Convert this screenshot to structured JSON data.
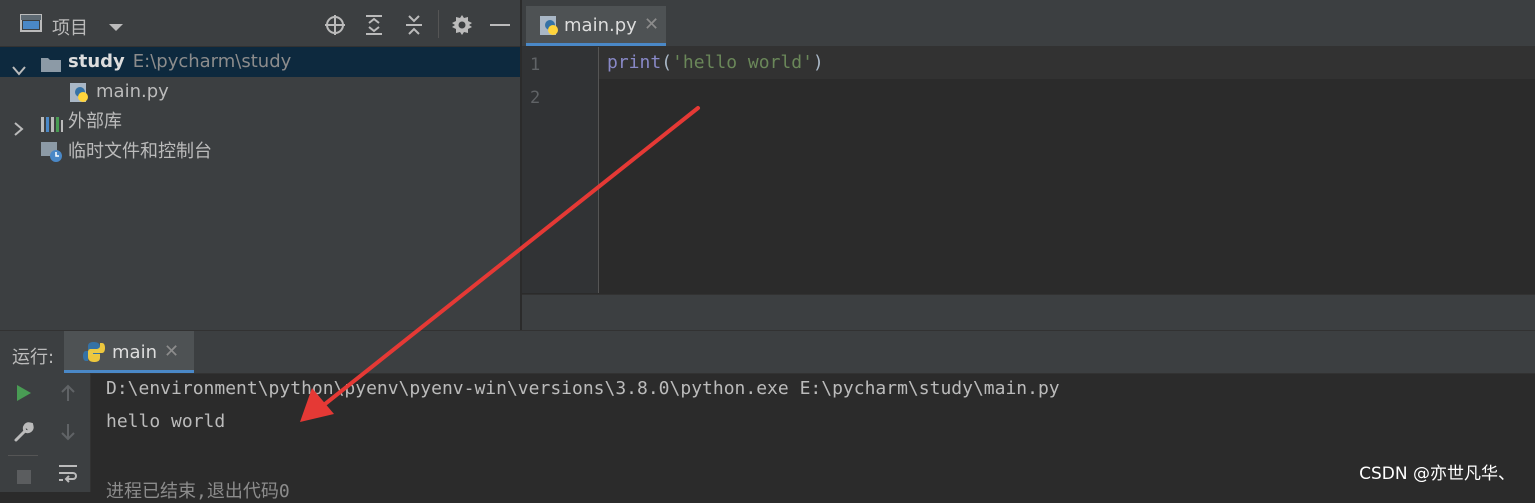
{
  "project": {
    "title": "项目",
    "tree": [
      {
        "name": "study",
        "path": "E:\\pycharm\\study"
      },
      {
        "name": "main.py"
      },
      {
        "name": "外部库"
      },
      {
        "name": "临时文件和控制台"
      }
    ]
  },
  "editor": {
    "tab": {
      "label": "main.py",
      "close": "✕"
    },
    "line_numbers": [
      "1",
      "2"
    ],
    "code": {
      "keyword": "print",
      "open": "(",
      "string": "'hello world'",
      "close": ")"
    }
  },
  "run": {
    "title": "运行:",
    "tab": {
      "label": "main",
      "close": "✕"
    },
    "console": [
      "D:\\environment\\python\\pyenv\\pyenv-win\\versions\\3.8.0\\python.exe E:\\pycharm\\study\\main.py",
      "hello world",
      "",
      "进程已结束,退出代码0"
    ]
  },
  "watermark": "CSDN @亦世凡华、",
  "colors": {
    "accent": "#4a88c7",
    "annotation_arrow": "#e53935",
    "run_green": "#499c54"
  }
}
